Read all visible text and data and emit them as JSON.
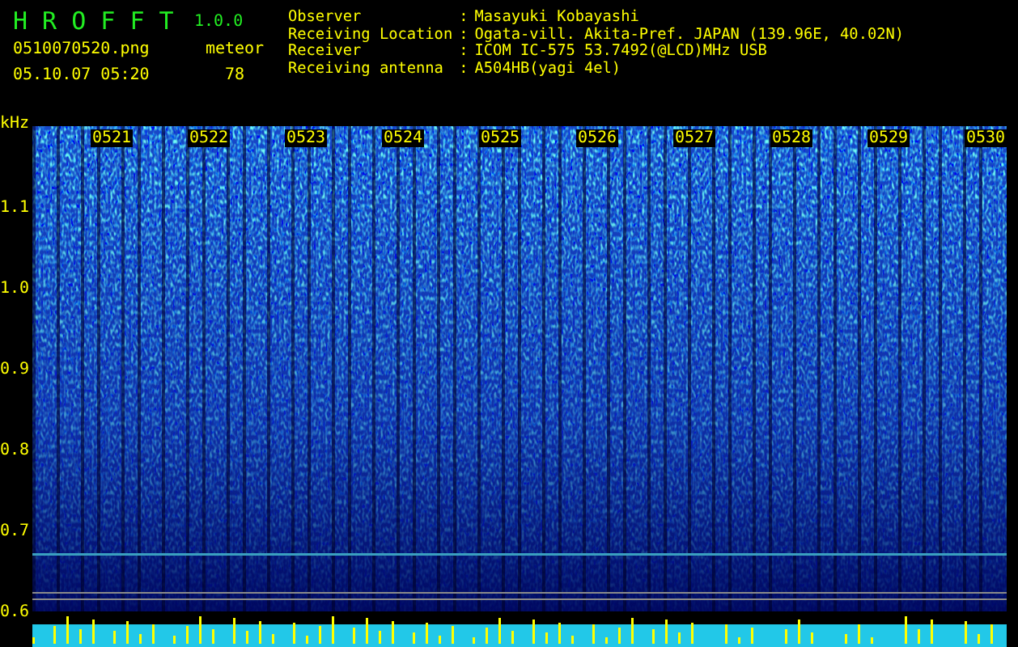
{
  "app": {
    "name": "H R O F F T",
    "version": "1.0.0"
  },
  "file_name": "0510070520.png",
  "date_time": "05.10.07 05:20",
  "meteor": {
    "label": "meteor",
    "count": "78"
  },
  "station_info": [
    {
      "label": "Observer",
      "separator": ":",
      "value": "Masayuki Kobayashi"
    },
    {
      "label": "Receiving Location",
      "separator": ":",
      "value": "Ogata-vill. Akita-Pref. JAPAN (139.96E, 40.02N)"
    },
    {
      "label": "Receiver",
      "separator": ":",
      "value": "ICOM IC-575 53.7492(@LCD)MHz USB"
    },
    {
      "label": "Receiving antenna",
      "separator": ":",
      "value": "A504HB(yagi 4el)"
    }
  ],
  "spectrogram": {
    "unit": "kHz",
    "y_labels": [
      "1.1",
      "1.0",
      "0.9",
      "0.8",
      "0.7",
      "0.6"
    ],
    "time_labels": [
      "0521",
      "0522",
      "0523",
      "0524",
      "0525",
      "0526",
      "0527",
      "0528",
      "0529",
      "0530"
    ]
  }
}
